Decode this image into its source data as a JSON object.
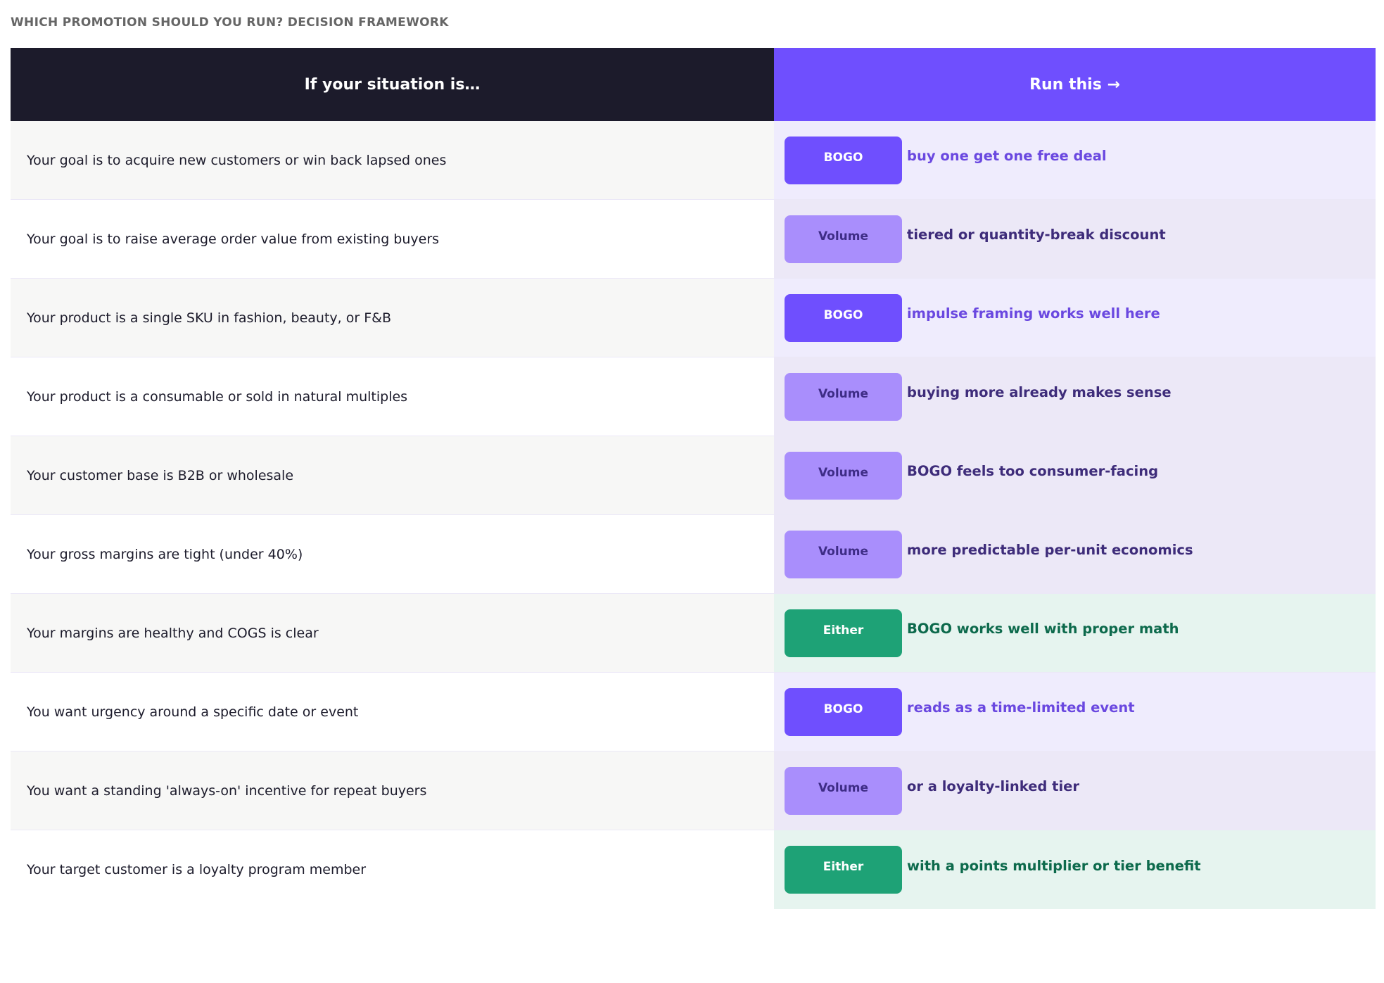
{
  "page": {
    "title": "WHICH PROMOTION SHOULD YOU RUN? DECISION FRAMEWORK"
  },
  "table": {
    "headers": {
      "situation": "If your situation is…",
      "action": "Run this →"
    },
    "rows": [
      {
        "situation": "Your goal is to acquire new customers or win back lapsed ones",
        "badge": "BOGO",
        "type": "bogo",
        "note": "buy one get one free deal"
      },
      {
        "situation": "Your goal is to raise average order value from existing buyers",
        "badge": "Volume",
        "type": "volume",
        "note": "tiered or quantity-break discount"
      },
      {
        "situation": "Your product is a single SKU in fashion, beauty, or F&B",
        "badge": "BOGO",
        "type": "bogo",
        "note": "impulse framing works well here"
      },
      {
        "situation": "Your product is a consumable or sold in natural multiples",
        "badge": "Volume",
        "type": "volume",
        "note": "buying more already makes sense"
      },
      {
        "situation": "Your customer base is B2B or wholesale",
        "badge": "Volume",
        "type": "volume",
        "note": "BOGO feels too consumer-facing"
      },
      {
        "situation": "Your gross margins are tight (under 40%)",
        "badge": "Volume",
        "type": "volume",
        "note": "more predictable per-unit economics"
      },
      {
        "situation": "Your margins are healthy and COGS is clear",
        "badge": "Either",
        "type": "either",
        "note": "BOGO works well with proper math"
      },
      {
        "situation": "You want urgency around a specific date or event",
        "badge": "BOGO",
        "type": "bogo",
        "note": "reads as a time-limited event"
      },
      {
        "situation": "You want a standing 'always-on' incentive for repeat buyers",
        "badge": "Volume",
        "type": "volume",
        "note": "or a loyalty-linked tier"
      },
      {
        "situation": "Your target customer is a loyalty program member",
        "badge": "Either",
        "type": "either",
        "note": "with a points multiplier or tier benefit"
      }
    ]
  },
  "colors": {
    "header_dark": "#1c1b2b",
    "accent_purple": "#6f4ffe",
    "volume_light_purple": "#a98efc",
    "either_green": "#1ea276"
  }
}
